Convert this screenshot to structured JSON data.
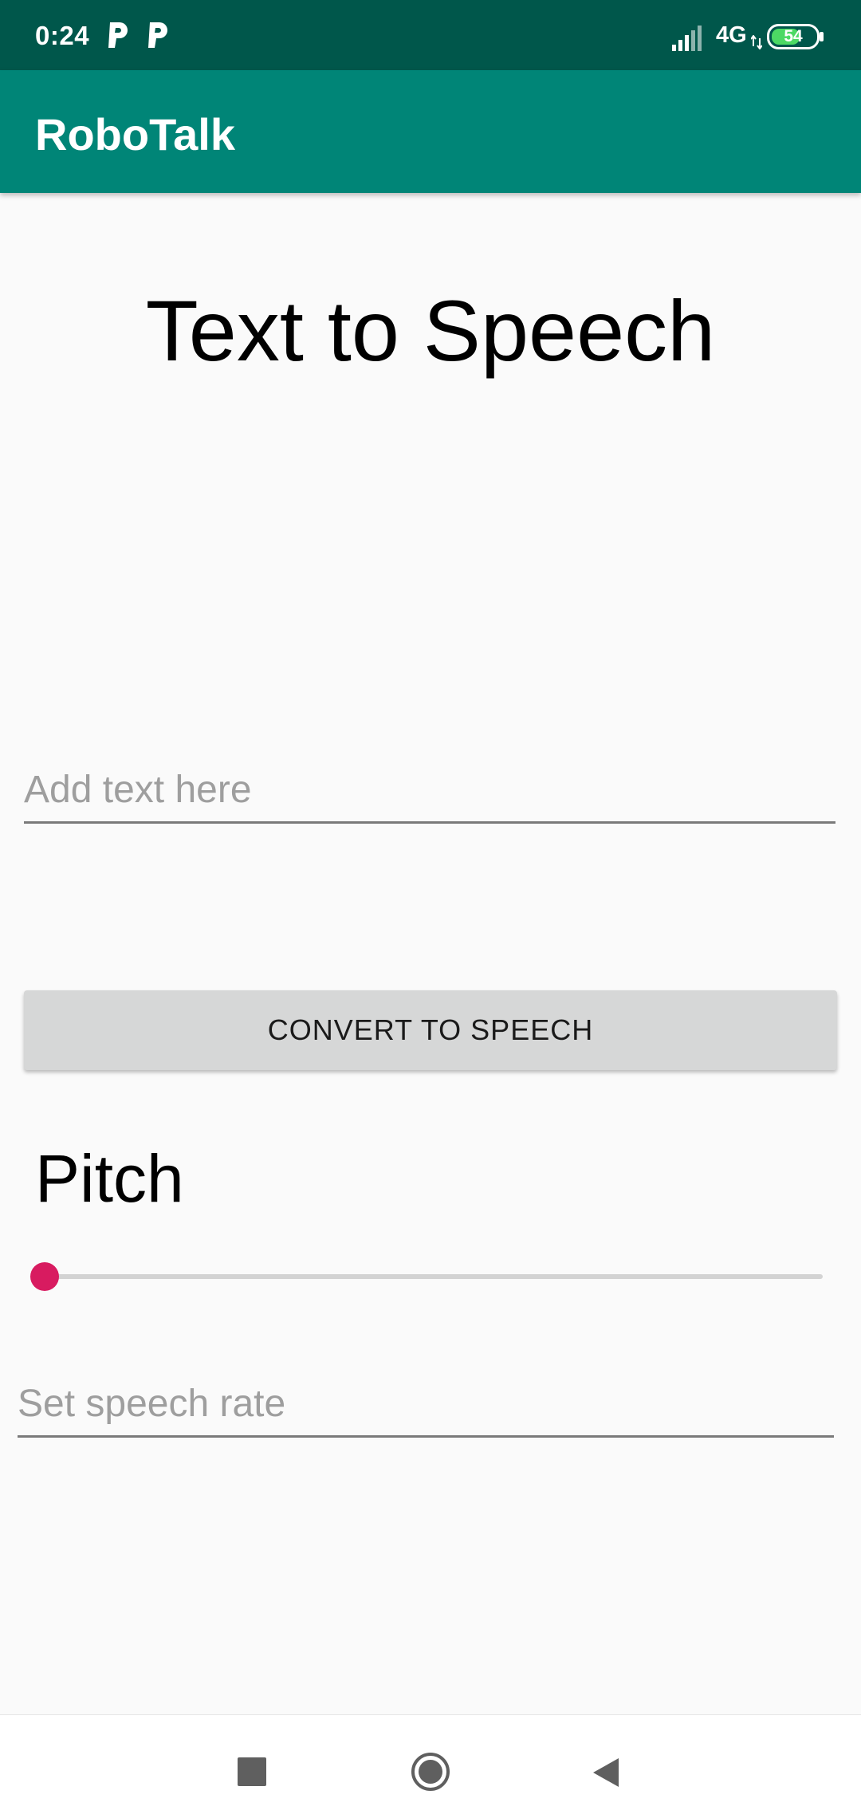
{
  "status_bar": {
    "time": "0:24",
    "network": "4G",
    "battery": "54",
    "icons": [
      "parking-app-icon",
      "parking-app-icon",
      "signal-icon",
      "network-arrows-icon",
      "battery-icon"
    ],
    "battery_color": "#4cd964"
  },
  "app_bar": {
    "title": "RoboTalk",
    "color": "#008577"
  },
  "main": {
    "heading": "Text to Speech",
    "text_input": {
      "value": "",
      "placeholder": "Add text here"
    },
    "convert_button": {
      "label": "CONVERT TO SPEECH"
    },
    "pitch": {
      "label": "Pitch",
      "slider_value": 0,
      "thumb_color": "#d81b60"
    },
    "rate_input": {
      "value": "",
      "placeholder": "Set speech rate"
    }
  },
  "nav_bar": {
    "icons": [
      "recents-icon",
      "home-icon",
      "back-icon"
    ]
  }
}
